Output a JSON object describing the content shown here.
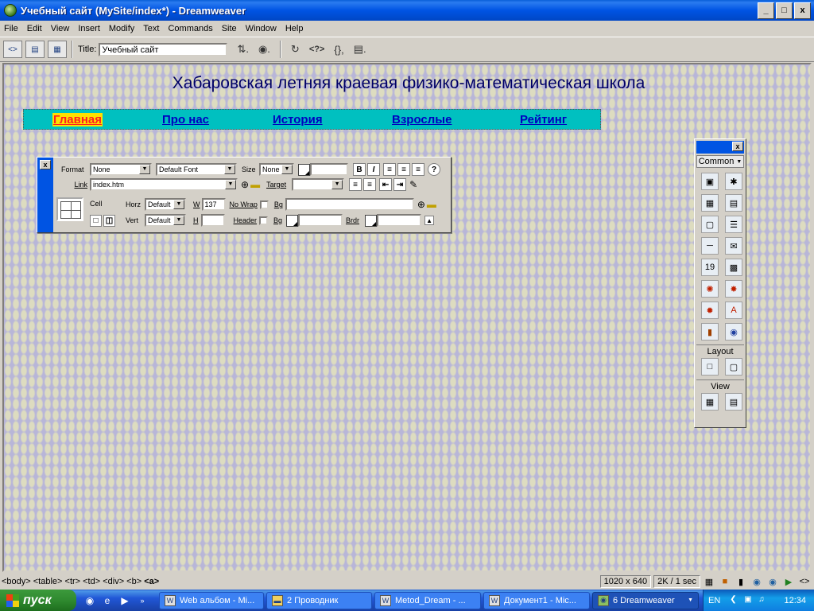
{
  "window": {
    "title": "Учебный сайт (MySite/index*) - Dreamweaver",
    "controls": [
      "_",
      "□",
      "x"
    ]
  },
  "menu": [
    "File",
    "Edit",
    "View",
    "Insert",
    "Modify",
    "Text",
    "Commands",
    "Site",
    "Window",
    "Help"
  ],
  "doc_toolbar": {
    "title_label": "Title:",
    "title_value": "Учебный сайт"
  },
  "page": {
    "heading": "Хабаровская летняя краевая физико-математическая школа",
    "nav": [
      {
        "label": "Главная",
        "active": true
      },
      {
        "label": "Про нас",
        "active": false
      },
      {
        "label": "История",
        "active": false
      },
      {
        "label": "Взрослые",
        "active": false
      },
      {
        "label": "Рейтинг",
        "active": false
      }
    ]
  },
  "properties": {
    "format_label": "Format",
    "format_value": "None",
    "font_value": "Default Font",
    "size_label": "Size",
    "size_value": "None",
    "bold": "B",
    "italic": "I",
    "link_label": "Link",
    "link_value": "index.htm",
    "target_label": "Target",
    "cell_label": "Cell",
    "horz_label": "Horz",
    "horz_value": "Default",
    "w_label": "W",
    "w_value": "137",
    "nowrap_label": "No Wrap",
    "bg_label": "Bg",
    "vert_label": "Vert",
    "vert_value": "Default",
    "h_label": "H",
    "header_label": "Header",
    "bg2_label": "Bg",
    "brdr_label": "Brdr"
  },
  "insert_panel": {
    "category": "Common",
    "layout_label": "Layout",
    "view_label": "View"
  },
  "status": {
    "tag_path": "<body> <table> <tr> <td> <div> <b> ",
    "tag_selected": "<a>",
    "window_size": "1020 x 640",
    "download": "2K / 1 sec"
  },
  "taskbar": {
    "start_label": "пуск",
    "tasks": [
      {
        "label": "Web альбом - Mi...",
        "active": false
      },
      {
        "label": "2 Проводник",
        "active": false
      },
      {
        "label": "Metod_Dream - ...",
        "active": false
      },
      {
        "label": "Документ1 - Mic...",
        "active": false
      },
      {
        "label": "6 Dreamweaver",
        "active": true
      }
    ],
    "lang": "EN",
    "clock": "12:34"
  }
}
